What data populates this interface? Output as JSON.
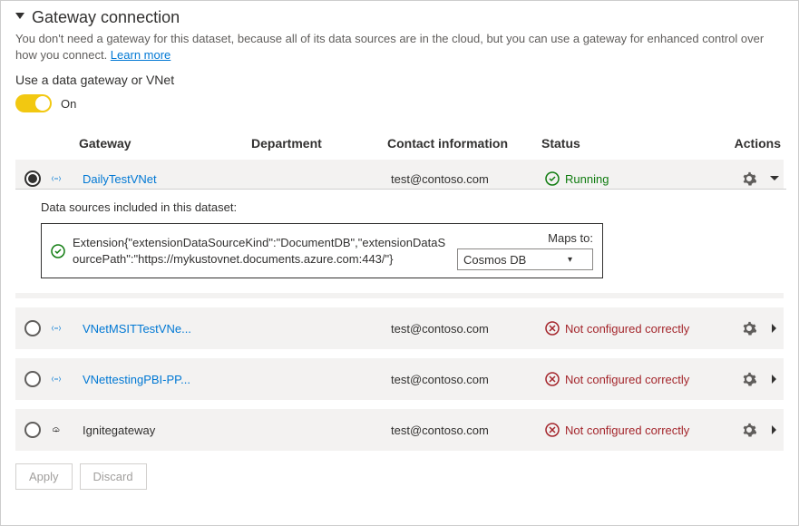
{
  "section": {
    "title": "Gateway connection",
    "description_pre": "You don't need a gateway for this dataset, because all of its data sources are in the cloud, but you can use a gateway for enhanced control over how you connect. ",
    "learn_more": "Learn more",
    "use_gateway_label": "Use a data gateway or VNet",
    "toggle_state": "On"
  },
  "columns": {
    "gateway": "Gateway",
    "department": "Department",
    "contact": "Contact information",
    "status": "Status",
    "actions": "Actions"
  },
  "gateways": [
    {
      "selected": true,
      "icon": "vnet",
      "name": "DailyTestVNet",
      "department": "",
      "contact": "test@contoso.com",
      "status_kind": "ok",
      "status_text": "Running",
      "expanded": true
    },
    {
      "selected": false,
      "icon": "vnet",
      "name": "VNetMSITTestVNe...",
      "department": "",
      "contact": "test@contoso.com",
      "status_kind": "bad",
      "status_text": "Not configured correctly",
      "expanded": false
    },
    {
      "selected": false,
      "icon": "vnet",
      "name": "VNettestingPBI-PP...",
      "department": "",
      "contact": "test@contoso.com",
      "status_kind": "bad",
      "status_text": "Not configured correctly",
      "expanded": false
    },
    {
      "selected": false,
      "icon": "cloud",
      "name": "Ignitegateway",
      "department": "",
      "contact": "test@contoso.com",
      "status_kind": "bad",
      "status_text": "Not configured correctly",
      "expanded": false
    }
  ],
  "expanded": {
    "caption": "Data sources included in this dataset:",
    "datasource_text": "Extension{\"extensionDataSourceKind\":\"DocumentDB\",\"extensionDataSourcePath\":\"https://mykustovnet.documents.azure.com:443/\"}",
    "maps_to_label": "Maps to:",
    "maps_to_value": "Cosmos DB"
  },
  "buttons": {
    "apply": "Apply",
    "discard": "Discard"
  }
}
